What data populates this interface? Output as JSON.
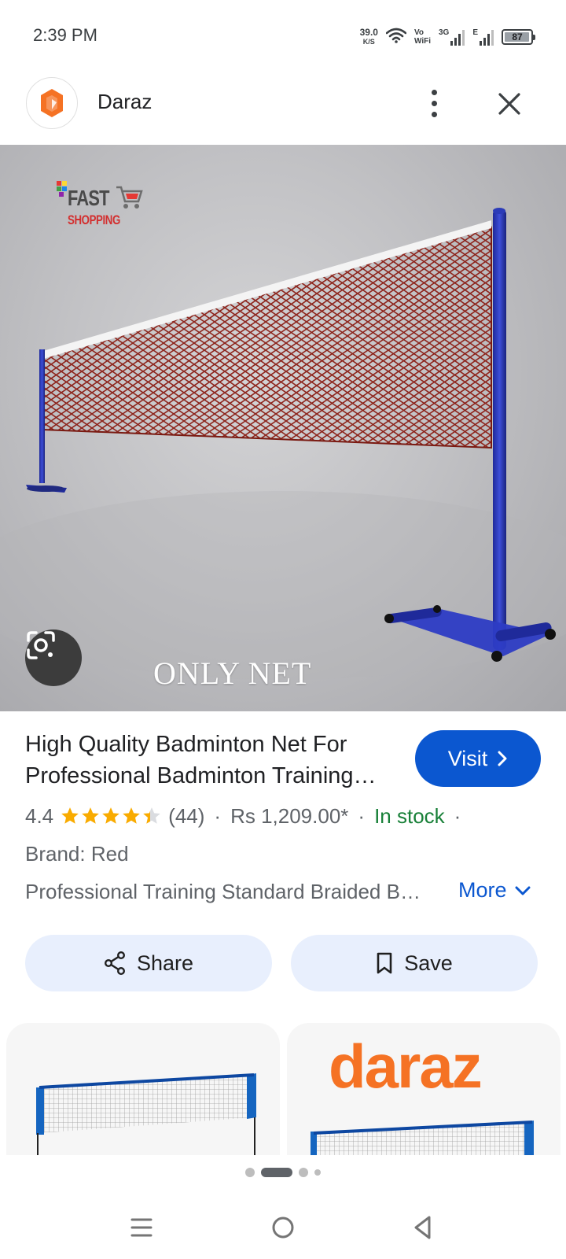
{
  "status_bar": {
    "time": "2:39 PM",
    "net_speed": "39.0",
    "net_speed_unit": "K/S",
    "vowifi_top": "Vo",
    "vowifi_bottom": "WiFi",
    "network_3g": "3G",
    "network_e": "E",
    "battery_level": "87",
    "battery_fraction": 0.87
  },
  "header": {
    "site_name": "Daraz",
    "logo_icon": "daraz-logo-icon",
    "menu_icon": "more-vert-icon",
    "close_icon": "close-icon"
  },
  "hero": {
    "caption": "ONLY NET",
    "watermark_line1": "FAST",
    "watermark_line2": "SHOPPING",
    "lens_icon": "google-lens-icon"
  },
  "product": {
    "title": "High Quality Badminton Net For Professional Badminton Training Standard Braided",
    "visit_label": "Visit",
    "rating": "4.4",
    "rating_value": 4.4,
    "review_count": "(44)",
    "price": "Rs 1,209.00*",
    "availability": "In stock",
    "trailing_sep": "·",
    "brand": "Brand: Red",
    "description": "Professional Training Standard Braided Badminton Net",
    "more_label": "More"
  },
  "actions": {
    "share_label": "Share",
    "save_label": "Save"
  },
  "related": {
    "card2_brand": "daraz"
  },
  "pager": {
    "count": 4,
    "active": 1
  },
  "colors": {
    "accent": "#0b57d0",
    "stock_green": "#188038",
    "star": "#f9ab00",
    "pill_bg": "#e8effd",
    "daraz_orange": "#f57224"
  }
}
